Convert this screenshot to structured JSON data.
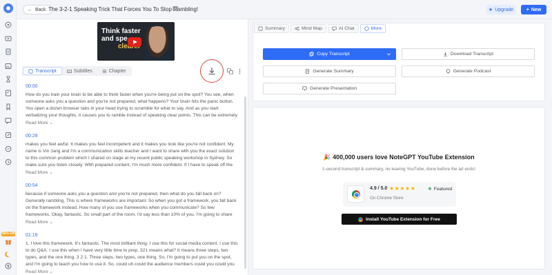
{
  "header": {
    "back_label": "Back",
    "title": "The 3-2-1 Speaking Trick That Forces You To Stop Rambling!",
    "upgrade_label": "Upgrade",
    "new_label": "New"
  },
  "sidebar": {
    "promo_badge": "50% Off"
  },
  "video": {
    "thumb_line1": "Think faster",
    "thumb_line2": "and spe",
    "thumb_line3": "clearer"
  },
  "left_tabs": [
    {
      "label": "Transcript"
    },
    {
      "label": "Subtitles"
    },
    {
      "label": "Chapter"
    }
  ],
  "transcript": [
    {
      "time": "00:00",
      "text": "How do you train your brain to be able to think faster when you're being put on the spot? You see, when someone asks you a question and you're not prepared, what happens? Your brain hits the panic button. You open a dozen browser tabs in your head trying to scramble for what to say. And as you start verbalizing your thoughts, it causes you to ramble instead of speaking clear points. This can be extremely frustrating and sometimes even embarrassing. How do I know...",
      "more": "Read More"
    },
    {
      "time": "00:28",
      "text": "makes you feel awful. It makes you feel incompetent and it makes you look like you're not confident. My name is Vin Jang and I'm a communication skills teacher and I want to share with you the exact solution to this common problem which I shared on stage at my recent public speaking workshop in Sydney. So make sure you listen closely. With prepared content, I'm much more confident. If I have to speak off the cuff, a lot less confident. Okay, so this is really ...",
      "more": "Read More"
    },
    {
      "time": "00:54",
      "text": "because if someone asks you a question and you're not prepared, then what do you fall back on? Generally rambling. This is where frameworks are important. So when you got a framework, you fall back on the framework instead. How many of you use frameworks when you communicate? So few frameworks. Okay, fantastic. So small part of the room, I'd say less than 10% of you. I'm going to share with you a very simple framework. This is one I still use and I'm ...",
      "more": "Read More"
    },
    {
      "time": "01:18",
      "text": "1. I love this framework. It's fantastic. The most brilliant thing. I use this for social media content. I use this to do Q&A. I use this when I have very little time to prep. 321 means what? It means three steps, two types, and the one thing. 3 2 1. Three steps, two types, one thing. So, I'm going to put you on the spot, and I'm going to teach you how to use it. So, could uh could the audience members could you could you give me a random topic? Sorry. Avocados. Avocados. This ...",
      "more": "Read More"
    }
  ],
  "right_tabs": [
    {
      "label": "Summary"
    },
    {
      "label": "Mind Map"
    },
    {
      "label": "AI Chat"
    },
    {
      "label": "More"
    }
  ],
  "actions": {
    "copy": "Copy Transcript",
    "download": "Download Transcript",
    "summary": "Generate Summary",
    "podcast": "Generate Podcast",
    "presentation": "Generate Presentation"
  },
  "promo": {
    "title": "400,000 users love NoteGPT YouTube Extension",
    "subtitle": "1-second transcript & summary, no leaving YouTube, done before the ad ends!",
    "rating": "4.9 / 5.0",
    "stars": "★★★★★",
    "featured": "Featured",
    "store": "On Chrome Store",
    "install": "Install YouTube Extension for Free"
  }
}
